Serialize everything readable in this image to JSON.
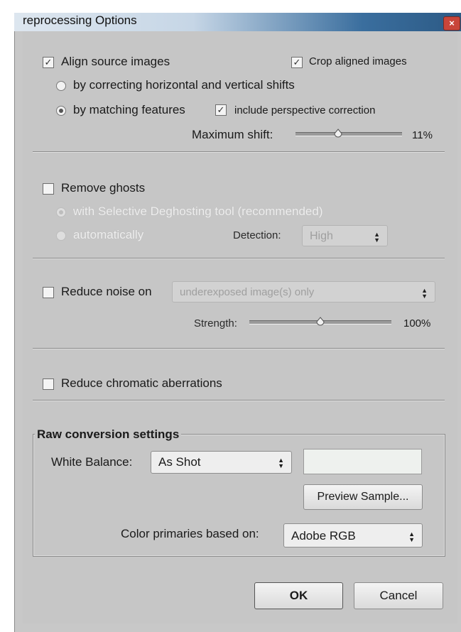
{
  "window": {
    "title": "Preprocessing Options",
    "title_visible": "reprocessing Options",
    "close_glyph": "×"
  },
  "align": {
    "label": "Align source images",
    "checked": true,
    "crop_label": "Crop aligned images",
    "crop_checked": true,
    "option_shifts": "by correcting horizontal and vertical shifts",
    "option_features": "by matching features",
    "selected": "by matching features",
    "perspective_label": "include perspective correction",
    "perspective_checked": true,
    "max_shift_label": "Maximum shift:",
    "max_shift_value": "11%",
    "max_shift_fraction": 0.4
  },
  "ghosts": {
    "label": "Remove ghosts",
    "checked": false,
    "option_selective": "with Selective Deghosting tool (recommended)",
    "option_auto": "automatically",
    "detection_label": "Detection:",
    "detection_value": "High"
  },
  "noise": {
    "label": "Reduce noise on",
    "checked": false,
    "target_value": "underexposed image(s) only",
    "strength_label": "Strength:",
    "strength_value": "100%",
    "strength_fraction": 0.5
  },
  "chromatic": {
    "label": "Reduce chromatic aberrations",
    "checked": false
  },
  "raw": {
    "group_title": "Raw conversion settings",
    "wb_label": "White Balance:",
    "wb_value": "As Shot",
    "preview_button": "Preview Sample...",
    "primaries_label": "Color primaries based on:",
    "primaries_value": "Adobe RGB"
  },
  "buttons": {
    "ok": "OK",
    "cancel": "Cancel"
  },
  "glyphs": {
    "check": "✓",
    "updown": "▲▼"
  }
}
